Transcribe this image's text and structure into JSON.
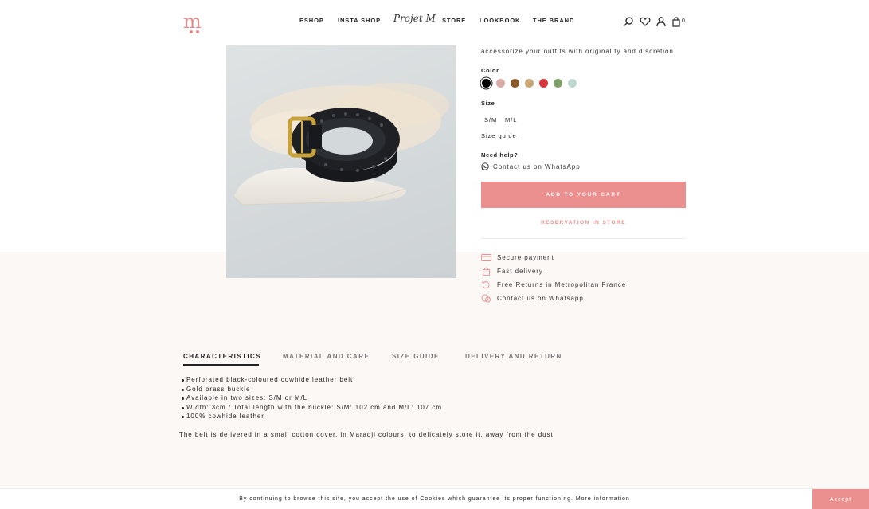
{
  "header": {
    "logo_text": "m",
    "nav": [
      "ESHOP",
      "INSTA SHOP",
      "STORE",
      "LOOKBOOK",
      "THE BRAND"
    ],
    "nav_script": "Projet M",
    "cart_count": "0",
    "icons": [
      "search-icon",
      "heart-icon",
      "user-icon",
      "bag-icon"
    ]
  },
  "product": {
    "description_line": "accessorize your outfits with originality and discretion",
    "color_label": "Color",
    "colors": [
      "#000000",
      "#d9aaa6",
      "#8a5a2b",
      "#c9a875",
      "#d9363b",
      "#7fa068",
      "#bfd8cf"
    ],
    "selected_color_index": 0,
    "size_label": "Size",
    "sizes": [
      "S/M",
      "M/L"
    ],
    "size_guide": "Size guide",
    "help_label": "Need help?",
    "whatsapp": "Contact us on WhatsApp",
    "add_to_cart": "ADD TO YOUR CART",
    "reservation": "RESERVATION IN STORE"
  },
  "benefits": [
    {
      "icon": "card-icon",
      "label": "Secure payment"
    },
    {
      "icon": "bag-icon",
      "label": "Fast delivery"
    },
    {
      "icon": "return-icon",
      "label": "Free Returns in Metropolitan France"
    },
    {
      "icon": "chat-icon",
      "label": "Contact us on Whatsapp"
    }
  ],
  "tabs": [
    "CHARACTERISTICS",
    "MATERIAL AND CARE",
    "SIZE GUIDE",
    "DELIVERY AND RETURN"
  ],
  "active_tab_index": 0,
  "characteristics": [
    "Perforated black-coloured cowhide leather belt",
    "Gold brass buckle",
    "Available in two sizes: S/M or M/L",
    "Width: 3cm / Total length with the buckle: S/M: 102 cm and M/L: 107 cm",
    "100% cowhide leather"
  ],
  "note": "The belt is delivered in a small cotton cover, in Maradji colours, to delicately store it, away from the dust",
  "cookie": {
    "text": "By continuing to browse this site, you accept the use of Cookies which guarantee its proper functioning. More information",
    "accept": "Accept"
  }
}
